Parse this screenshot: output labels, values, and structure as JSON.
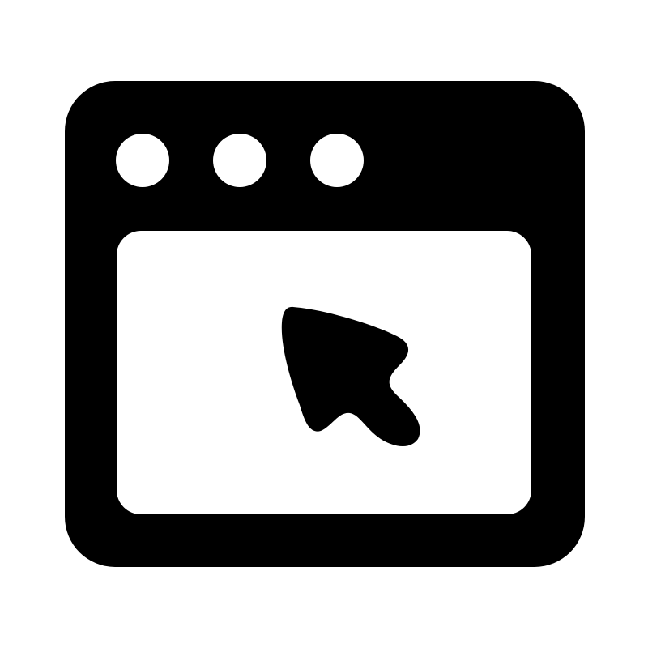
{
  "icon": {
    "name": "browser-window-cursor-icon",
    "parts": {
      "frame": "window-frame",
      "controls": [
        "window-dot-1",
        "window-dot-2",
        "window-dot-3"
      ],
      "viewport": "window-content-area",
      "pointer": "mouse-pointer-icon"
    }
  },
  "colors": {
    "foreground": "#000000",
    "background": "#ffffff"
  }
}
